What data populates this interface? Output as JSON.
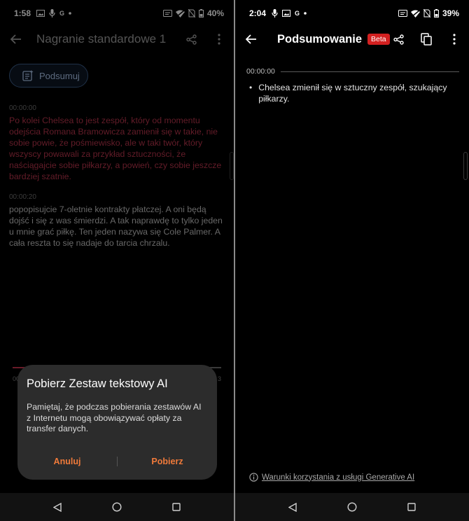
{
  "left": {
    "status": {
      "time": "1:58",
      "g_label": "G",
      "battery": "40%"
    },
    "appbar": {
      "title": "Nagranie standardowe 1"
    },
    "summarize_button": {
      "label": "Podsumuj"
    },
    "segments": [
      {
        "time": "00:00:00",
        "text": "Po kolei Chelsea to jest zespół, który od momentu odejścia Romana Bramowicza zamienił się w takie, nie sobie powie, że pośmiewisko, ale w taki twór, który wszyscy powawali za przykład sztuczności, że naściągajcie sobie piłkarzy, a powień, czy sobie jeszcze bardziej szatnie."
      },
      {
        "time": "00:00:20",
        "text": "popopisujcie 7-oletnie kontrakty płatczej. A oni będą dojść i się z was śmierdzi. A tak naprawdę to tylko jeden u mnie grać piłkę. Ten jeden nazywa się Cole Palmer. A cała reszta to się nadaje do tarcia chrzalu."
      }
    ],
    "player": {
      "elapsed": "00",
      "total": "3"
    },
    "dialog": {
      "title": "Pobierz Zestaw tekstowy AI",
      "body": "Pamiętaj, że podczas pobierania zestawów AI z Internetu mogą obowiązywać opłaty za transfer danych.",
      "cancel": "Anuluj",
      "confirm": "Pobierz"
    }
  },
  "right": {
    "status": {
      "time": "2:04",
      "g_label": "G",
      "battery": "39%"
    },
    "appbar": {
      "title": "Podsumowanie",
      "badge": "Beta"
    },
    "summary": {
      "timestamp": "00:00:00",
      "bullets": [
        "Chelsea zmienił się w sztuczny zespół, szukający piłkarzy."
      ]
    },
    "terms_link": "Warunki korzystania z usługi Generative AI"
  },
  "colors": {
    "accent_red": "#b3334a",
    "dialog_button": "#f07a3a",
    "beta_badge": "#d32020"
  }
}
